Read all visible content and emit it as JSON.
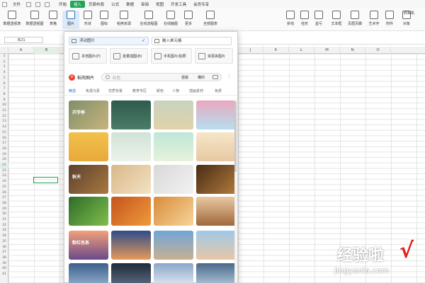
{
  "menu": {
    "file": "文件",
    "items": [
      "开始",
      "插入",
      "页面布局",
      "公式",
      "数据",
      "审阅",
      "视图",
      "开发工具",
      "会员专享"
    ],
    "active": "插入"
  },
  "ribbon": {
    "left": [
      "数据透视表",
      "数据透视图",
      "表格",
      "图片",
      "形状",
      "图标",
      "稻壳资源",
      "在线流程图",
      "在线脑图",
      "更多",
      "全部图表"
    ],
    "right": [
      "折线",
      "柱形",
      "盈亏",
      "文本框",
      "页眉页脚",
      "艺术字",
      "附件",
      "对象"
    ],
    "top_right": "照相机",
    "selected": "图片"
  },
  "formula_bar": {
    "name_box": "B21"
  },
  "columns": [
    "A",
    "B",
    "C",
    "D",
    "E",
    "F",
    "G",
    "H",
    "I",
    "J",
    "K",
    "L",
    "M",
    "N",
    "O"
  ],
  "rows": [
    "1",
    "2",
    "3",
    "4",
    "5",
    "6",
    "7",
    "8",
    "9",
    "10",
    "11",
    "12",
    "13",
    "14",
    "15",
    "16",
    "17",
    "18",
    "19",
    "20",
    "21",
    "22",
    "23",
    "24",
    "25",
    "26",
    "27",
    "28",
    "29",
    "30",
    "31",
    "32",
    "33",
    "34",
    "35",
    "36",
    "37",
    "38",
    "39",
    "40",
    "41"
  ],
  "panel": {
    "float_image": "浮动图片",
    "embed_cell": "嵌入单元格",
    "tiles": [
      "本地图片(P)",
      "批量插图(B)",
      "手机图片/拍照",
      "资源夹图片"
    ],
    "brand": "稻壳图片",
    "search_value": "红色",
    "search_filters": [
      "竖版",
      "横的"
    ],
    "categories": [
      "精选",
      "免抠元素",
      "优质背景",
      "教育专区",
      "颜色",
      "人物",
      "插画素材",
      "免费"
    ],
    "active_category": "精选",
    "captions": [
      "开学季",
      "秋天",
      "粉红色系"
    ]
  },
  "watermark": {
    "title": "经验啦",
    "check": "√",
    "url": "jingyanla.com"
  }
}
